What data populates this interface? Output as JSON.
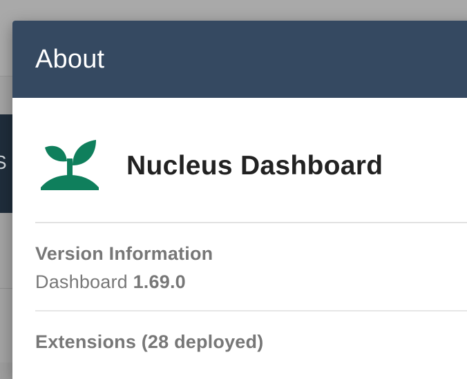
{
  "background": {
    "sidebar_glyph": "S"
  },
  "dialog": {
    "title": "About",
    "app": {
      "name": "Nucleus Dashboard",
      "logo_icon": "sprout-icon"
    },
    "version_info": {
      "heading": "Version Information",
      "label": "Dashboard",
      "version": "1.69.0"
    },
    "extensions": {
      "heading": "Extensions (28 deployed)"
    }
  },
  "colors": {
    "header_bg": "#354961",
    "logo_green": "#0f7f5c",
    "muted_text": "#777777"
  }
}
